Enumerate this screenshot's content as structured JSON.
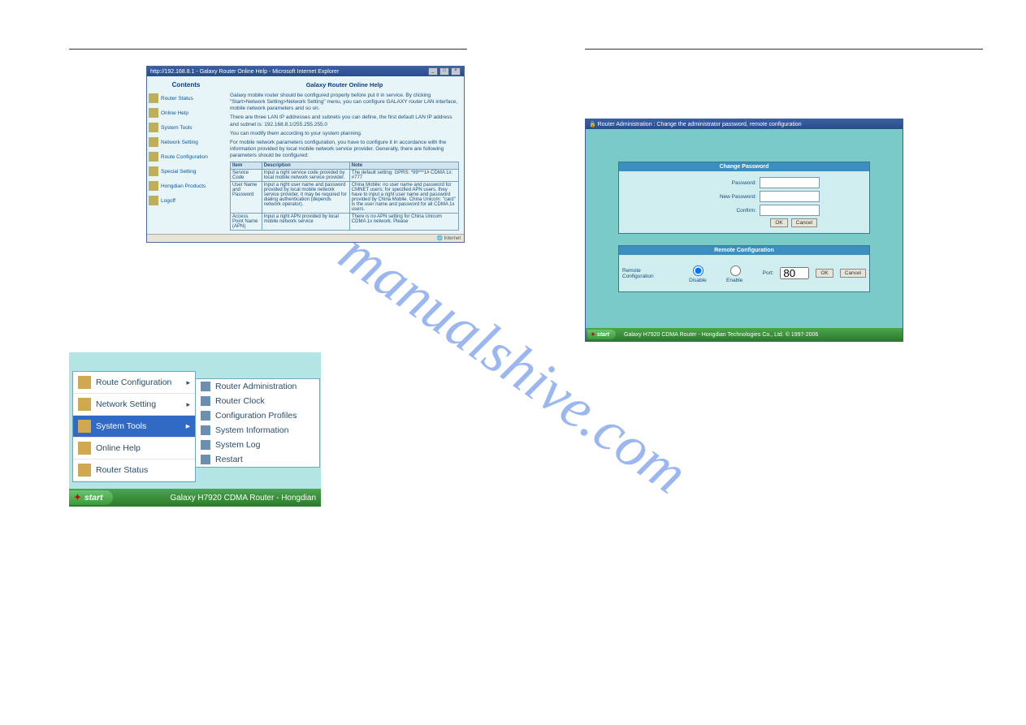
{
  "watermark": "manualshive.com",
  "help_window": {
    "title": "http://192.168.8.1 - Galaxy Router Online Help - Microsoft Internet Explorer",
    "nav_title": "Contents",
    "nav_items": [
      "Router Status",
      "Online Help",
      "System Tools",
      "Network Setting",
      "Route Configuration",
      "Special Setting",
      "Hongdian Products",
      "Logoff"
    ],
    "heading": "Galaxy Router Online Help",
    "para1": "Galaxy mobile router should be configured properly before put it in service. By clicking \"Start>Network Setting>Network Setting\" menu, you can configure GALAXY router LAN interface, mobile network parameters and so on.",
    "para2": "There are three LAN IP addresses and subnets you can define, the first default LAN IP address and subnet is: 192.168.8.1/255.255.255.0",
    "para3": "You can modify them according to your system planning.",
    "para4": "For mobile network parameters configuration, you have to configure it in accordance with the information provided by local mobile network service provider. Generally, there are following parameters should be configured:",
    "table": {
      "headers": [
        "Item",
        "Description",
        "Note"
      ],
      "rows": [
        {
          "item": "Service Code",
          "desc": "Input a right service code provided by local mobile network service provider.",
          "note": "The default setting: GPRS: *99***1# CDMA 1x: #777"
        },
        {
          "item": "User Name and Password",
          "desc": "Input a right user name and password provided by local mobile network service provider, it may be required for dialing authentication (depends network operator).",
          "note": "China Mobile: no user name and password for CMNET users; for specified APN users, they have to input a right user name and password provided by China Mobile. China Unicom: \"card\" is the user name and password for all CDMA 1x users."
        },
        {
          "item": "Access Point Name (APN)",
          "desc": "Input a right APN provided by local mobile network service",
          "note": "There is no APN setting for China Unicom CDMA 1x network. Please"
        }
      ]
    },
    "status": "Internet"
  },
  "start_menu": {
    "main": [
      {
        "label": "Route Configuration",
        "arrow": true
      },
      {
        "label": "Network Setting",
        "arrow": true
      },
      {
        "label": "System Tools",
        "arrow": true,
        "selected": true
      },
      {
        "label": "Online Help",
        "arrow": false
      },
      {
        "label": "Router Status",
        "arrow": false
      }
    ],
    "submenu": [
      "Router Administration",
      "Router Clock",
      "Configuration Profiles",
      "System Information",
      "System Log",
      "Restart"
    ],
    "start_label": "start",
    "taskbar_status": "Galaxy H7920 CDMA Router - Hongdian"
  },
  "admin_window": {
    "title": "Router Administration : Change the administrator password, remote configuration",
    "panel1_title": "Change Password",
    "pw_label": "Password:",
    "newpw_label": "New Password:",
    "confirm_label": "Confirm:",
    "ok": "OK",
    "cancel": "Cancel",
    "panel2_title": "Remote Configuration",
    "remote_label": "Remote Configuration",
    "disable": "Disable",
    "enable": "Enable",
    "port_label": "Port:",
    "port_value": "80",
    "start_label": "start",
    "taskbar_status": "Galaxy H7920 CDMA Router - Hongdian Technologies Co., Ltd. © 1997-2006"
  }
}
